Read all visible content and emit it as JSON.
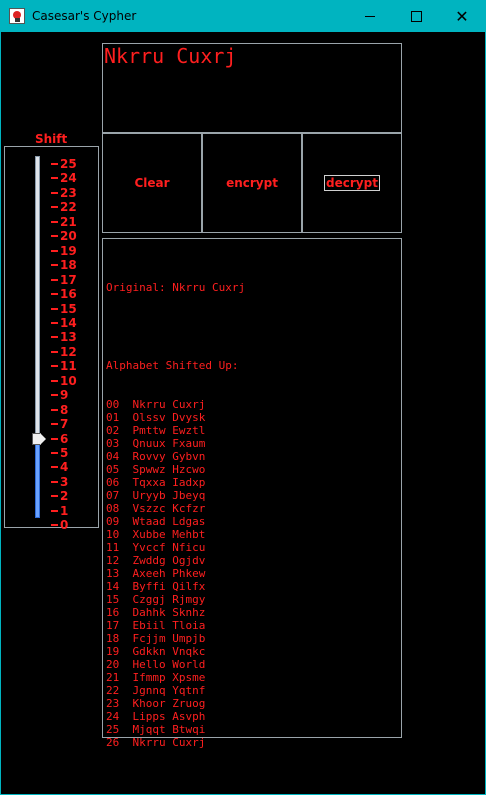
{
  "window": {
    "title": "Casesar's Cypher",
    "controls": [
      "minimize",
      "maximize",
      "close"
    ]
  },
  "shift": {
    "label": "Shift",
    "min": 0,
    "max": 25,
    "value": 6,
    "ticks": [
      "25",
      "24",
      "23",
      "22",
      "21",
      "20",
      "19",
      "18",
      "17",
      "16",
      "15",
      "14",
      "13",
      "12",
      "11",
      "10",
      "9",
      "8",
      "7",
      "6",
      "5",
      "4",
      "3",
      "2",
      "1",
      "0"
    ]
  },
  "message": {
    "value": "Nkrru Cuxrj"
  },
  "buttons": {
    "clear": "Clear",
    "encrypt": "encrypt",
    "decrypt": "decrypt"
  },
  "output": {
    "original_line": "Original: Nkrru Cuxrj",
    "header": "Alphabet Shifted Up:",
    "rows": [
      "00  Nkrru Cuxrj",
      "01  Olssv Dvysk",
      "02  Pmttw Ewztl",
      "03  Qnuux Fxaum",
      "04  Rovvy Gybvn",
      "05  Spwwz Hzcwo",
      "06  Tqxxa Iadxp",
      "07  Uryyb Jbeyq",
      "08  Vszzc Kcfzr",
      "09  Wtaad Ldgas",
      "10  Xubbe Mehbt",
      "11  Yvccf Nficu",
      "12  Zwddg Ogjdv",
      "13  Axeeh Phkew",
      "14  Byffi Qilfx",
      "15  Czggj Rjmgy",
      "16  Dahhk Sknhz",
      "17  Ebiil Tloia",
      "18  Fcjjm Umpjb",
      "19  Gdkkn Vnqkc",
      "20  Hello World",
      "21  Ifmmp Xpsme",
      "22  Jgnnq Yqtnf",
      "23  Khoor Zruog",
      "24  Lipps Asvph",
      "25  Mjqqt Btwqi",
      "26  Nkrru Cuxrj"
    ]
  },
  "colors": {
    "background": "#000000",
    "text": "#ff1f1f",
    "titlebar": "#00b4c0"
  }
}
